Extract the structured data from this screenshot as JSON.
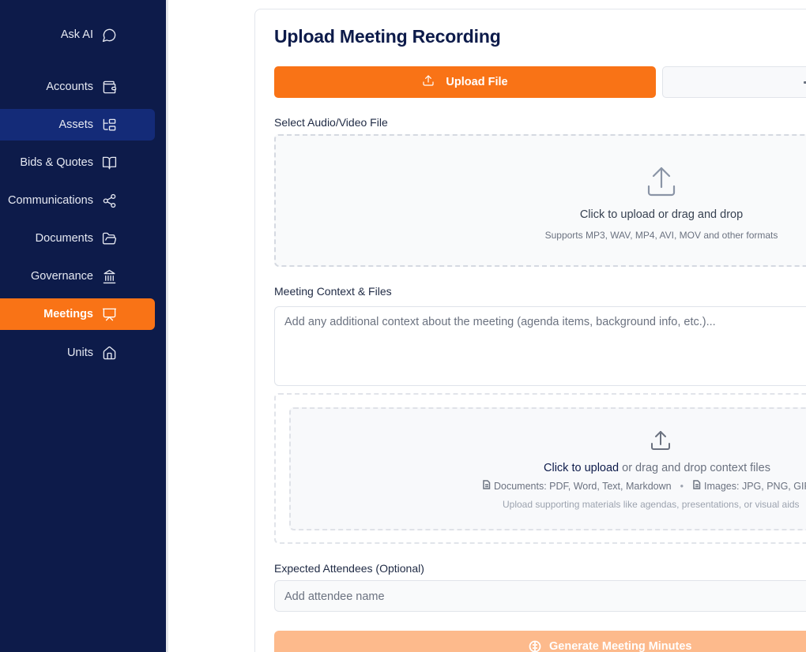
{
  "sidebar": {
    "items": [
      {
        "label": "Ask AI",
        "icon": "chat-bubble-icon"
      },
      {
        "label": "Accounts",
        "icon": "wallet-icon"
      },
      {
        "label": "Assets",
        "icon": "tree-structure-icon",
        "state": "hover"
      },
      {
        "label": "Bids & Quotes",
        "icon": "book-open-icon"
      },
      {
        "label": "Communications",
        "icon": "share-icon"
      },
      {
        "label": "Documents",
        "icon": "folder-open-icon"
      },
      {
        "label": "Governance",
        "icon": "landmark-icon"
      },
      {
        "label": "Meetings",
        "icon": "presentation-icon",
        "state": "active"
      },
      {
        "label": "Units",
        "icon": "home-icon"
      }
    ]
  },
  "main": {
    "title": "Upload Meeting Recording",
    "tabs": {
      "upload_label": "Upload File"
    },
    "file_section": {
      "label": "Select Audio/Video File",
      "drop_text": "Click to upload or drag and drop",
      "formats_text": "Supports MP3, WAV, MP4, AVI, MOV and other formats"
    },
    "context_section": {
      "label": "Meeting Context & Files",
      "placeholder": "Add any additional context about the meeting (agenda items, background info, etc.)...",
      "upload_link": "Click to upload",
      "upload_rest": " or drag and drop context files",
      "documents_types": "Documents: PDF, Word, Text, Markdown",
      "separator": "•",
      "images_types": "Images: JPG, PNG, GIF",
      "help_text": "Upload supporting materials like agendas, presentations, or visual aids"
    },
    "attendees_section": {
      "label": "Expected Attendees (Optional)",
      "placeholder": "Add attendee name"
    },
    "generate_label": "Generate Meeting Minutes"
  },
  "colors": {
    "sidebar_bg": "#0d1b4a",
    "accent": "#f97316",
    "hover_bg": "#142b78",
    "generate_disabled": "#fdba8c"
  }
}
